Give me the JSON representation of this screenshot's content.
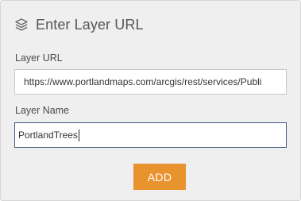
{
  "header": {
    "title": "Enter Layer URL",
    "icon": "layers-icon"
  },
  "form": {
    "url_label": "Layer URL",
    "url_value": "https://www.portlandmaps.com/arcgis/rest/services/Publi",
    "name_label": "Layer Name",
    "name_value": "PortlandTrees",
    "add_label": "ADD"
  },
  "colors": {
    "panel_bg": "#efefef",
    "accent": "#e9932f",
    "focus_border": "#3f5d7d"
  }
}
